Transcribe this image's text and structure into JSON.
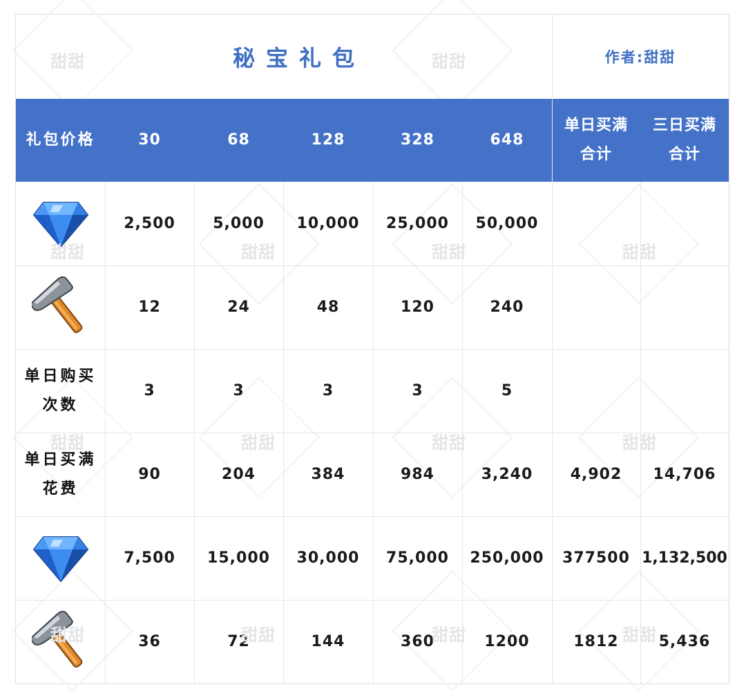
{
  "title": "秘宝礼包",
  "author": "作者:甜甜",
  "watermark": "甜甜",
  "header": {
    "label": "礼包价格",
    "prices": [
      "30",
      "68",
      "128",
      "328",
      "648"
    ],
    "total_day_line1": "单日买满",
    "total_day_line2": "合计",
    "total_three_line1": "三日买满",
    "total_three_line2": "合计"
  },
  "rows": {
    "gems": {
      "icon": "blue-gem-icon",
      "values": [
        "2,500",
        "5,000",
        "10,000",
        "25,000",
        "50,000"
      ]
    },
    "hammers": {
      "icon": "hammer-icon",
      "values": [
        "12",
        "24",
        "48",
        "120",
        "240"
      ]
    },
    "daily_count": {
      "label_line1": "单日购买",
      "label_line2": "次数",
      "values": [
        "3",
        "3",
        "3",
        "3",
        "5"
      ]
    },
    "daily_cost": {
      "label_line1": "单日买满",
      "label_line2": "花费",
      "values": [
        "90",
        "204",
        "384",
        "984",
        "3,240",
        "4,902",
        "14,706"
      ]
    },
    "total_gems": {
      "icon": "blue-gem-icon",
      "values": [
        "7,500",
        "15,000",
        "30,000",
        "75,000",
        "250,000",
        "377500",
        "1,132,500"
      ]
    },
    "total_hammers": {
      "icon": "hammer-icon",
      "values": [
        "36",
        "72",
        "144",
        "360",
        "1200",
        "1812",
        "5,436"
      ]
    }
  },
  "colors": {
    "header_bg": "#4472c9",
    "title_text": "#3f6fc4",
    "grid_line": "#e3e6ea"
  }
}
